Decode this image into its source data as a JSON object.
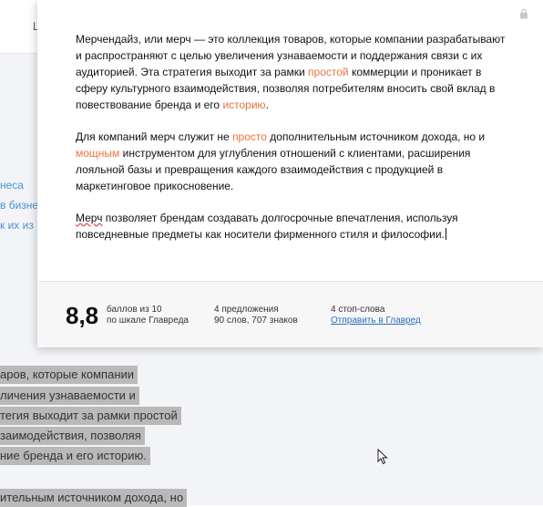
{
  "background": {
    "top_letter": "L",
    "links": [
      "неса",
      "в бизне",
      "к их из"
    ],
    "highlighted_lines": [
      "аров, которые компании",
      "личения узнаваемости и",
      "тегия выходит за рамки простой",
      "заимодействия, позволяя",
      "ние бренда и его историю.",
      "ительным источником дохода, но"
    ]
  },
  "editor": {
    "paragraphs": [
      {
        "parts": [
          {
            "text": "Мерчендайз, или мерч — это коллекция товаров, которые компании разрабатывают и распространяют с целью увеличения узнаваемости и поддержания связи с их аудиторией. Эта стратегия выходит за рамки ",
            "style": "normal"
          },
          {
            "text": "простой",
            "style": "highlight"
          },
          {
            "text": " коммерции и проникает в сферу культурного взаимодействия, позволяя потребителям вносить свой вклад в повествование бренда и его ",
            "style": "normal"
          },
          {
            "text": "историю",
            "style": "highlight"
          },
          {
            "text": ".",
            "style": "normal"
          }
        ]
      },
      {
        "parts": [
          {
            "text": "Для компаний мерч служит не ",
            "style": "normal"
          },
          {
            "text": "просто",
            "style": "highlight"
          },
          {
            "text": " дополнительным источником дохода, но и ",
            "style": "normal"
          },
          {
            "text": "мощным",
            "style": "highlight"
          },
          {
            "text": " инструментом для углубления отношений с клиентами, расширения лояльной базы и превращения каждого взаимодействия с продукцией в маркетинговое прикосновение.",
            "style": "normal"
          }
        ]
      },
      {
        "parts": [
          {
            "text": "Мерч",
            "style": "spell"
          },
          {
            "text": " позволяет брендам создавать долгосрочные впечатления, используя повседневные предметы как носители фирменного стиля и философии.",
            "style": "normal"
          }
        ]
      }
    ]
  },
  "stats": {
    "score": "8,8",
    "score_label_1": "баллов из 10",
    "score_label_2": "по шкале Главреда",
    "sentences": "4 предложения",
    "words_chars": "90 слов, 707 знаков",
    "stopwords": "4 стоп-слова",
    "send_link": "Отправить в Главред"
  },
  "colors": {
    "highlight": "#e8743a",
    "link": "#2a6ebb",
    "selection": "#b9b9b9"
  },
  "icons": [
    "lock-icon",
    "mouse-cursor-icon"
  ]
}
